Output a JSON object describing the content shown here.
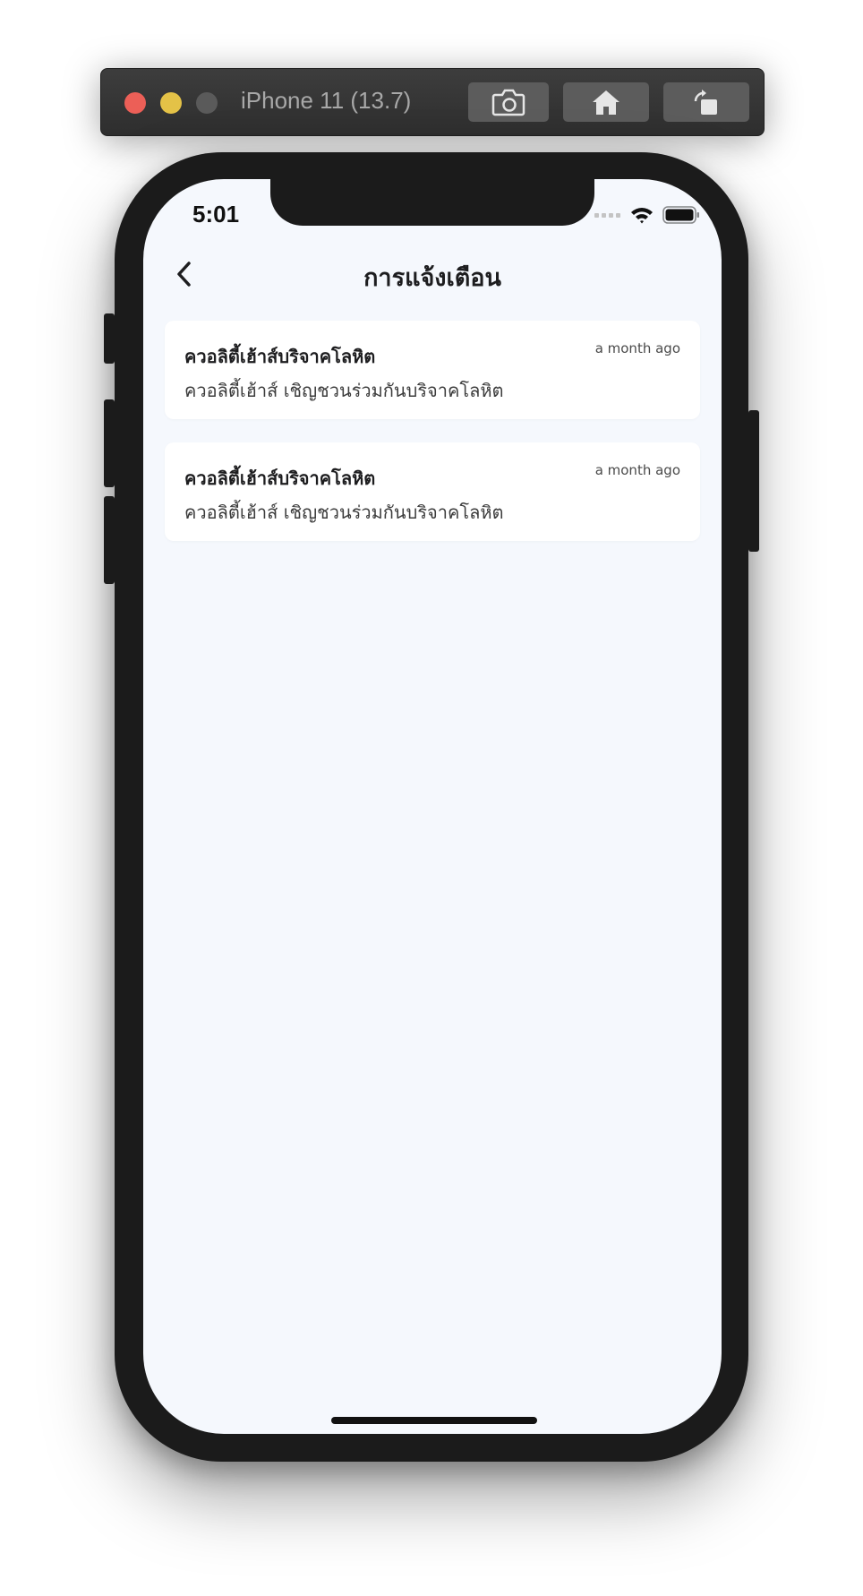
{
  "simulator": {
    "title": "iPhone 11 (13.7)",
    "buttons": [
      {
        "icon": "screenshot-icon"
      },
      {
        "icon": "home-icon"
      },
      {
        "icon": "rotate-icon"
      }
    ]
  },
  "status_bar": {
    "time": "5:01",
    "icons": [
      "signal-icon",
      "wifi-icon",
      "battery-icon"
    ]
  },
  "header": {
    "back_icon": "chevron-left-icon",
    "title": "การแจ้งเตือน"
  },
  "notifications": [
    {
      "title": "ควอลิตี้เฮ้าส์บริจาคโลหิต",
      "time": "a month ago",
      "body": "ควอลิตี้เฮ้าส์ เชิญชวนร่วมกันบริจาคโลหิต"
    },
    {
      "title": "ควอลิตี้เฮ้าส์บริจาคโลหิต",
      "time": "a month ago",
      "body": "ควอลิตี้เฮ้าส์ เชิญชวนร่วมกันบริจาคโลหิต"
    }
  ],
  "colors": {
    "screen_background": "#f5f8fd",
    "card_background": "#ffffff",
    "text_primary": "#1d1d1f",
    "text_secondary": "#3c3c3c",
    "close_light": "#ec5f57",
    "minimize_light": "#e4c247"
  }
}
